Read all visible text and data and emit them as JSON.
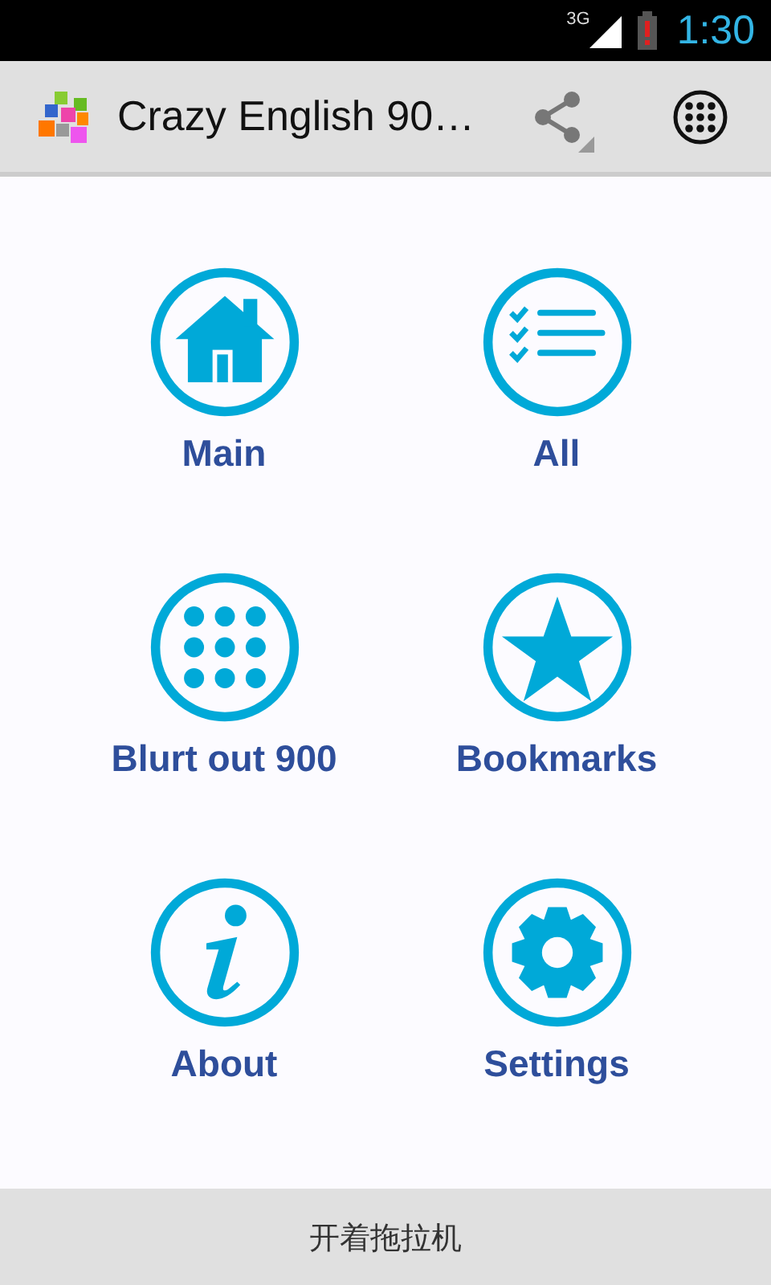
{
  "status_bar": {
    "network": "3G",
    "time": "1:30"
  },
  "action_bar": {
    "title": "Crazy English 90…"
  },
  "menu": [
    {
      "kind": "home",
      "label": "Main"
    },
    {
      "kind": "list",
      "label": "All"
    },
    {
      "kind": "dots",
      "label": "Blurt out 900"
    },
    {
      "kind": "star",
      "label": "Bookmarks"
    },
    {
      "kind": "info",
      "label": "About"
    },
    {
      "kind": "gear",
      "label": "Settings"
    }
  ],
  "footer": {
    "text": "开着拖拉机"
  }
}
